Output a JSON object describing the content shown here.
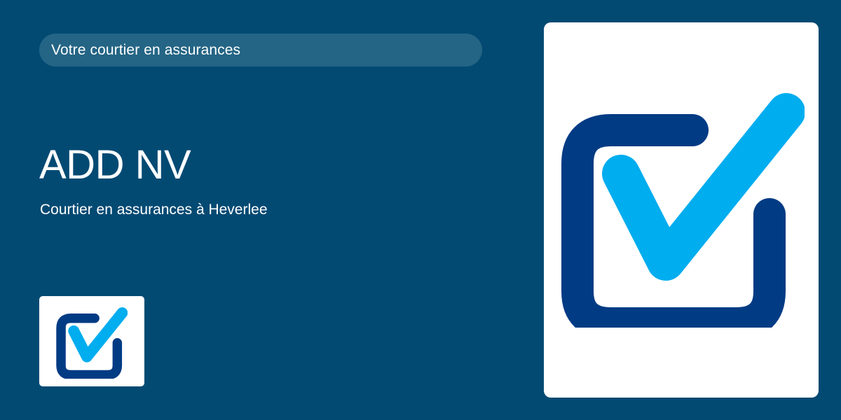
{
  "header": {
    "tagline": "Votre courtier en assurances"
  },
  "main": {
    "name": "ADD NV",
    "subtitle": "Courtier en assurances à Heverlee"
  },
  "logo": {
    "icon": "checkbox-check-icon",
    "colors": {
      "frame": "#003b84",
      "check": "#00adef",
      "background": "#034a73"
    }
  }
}
